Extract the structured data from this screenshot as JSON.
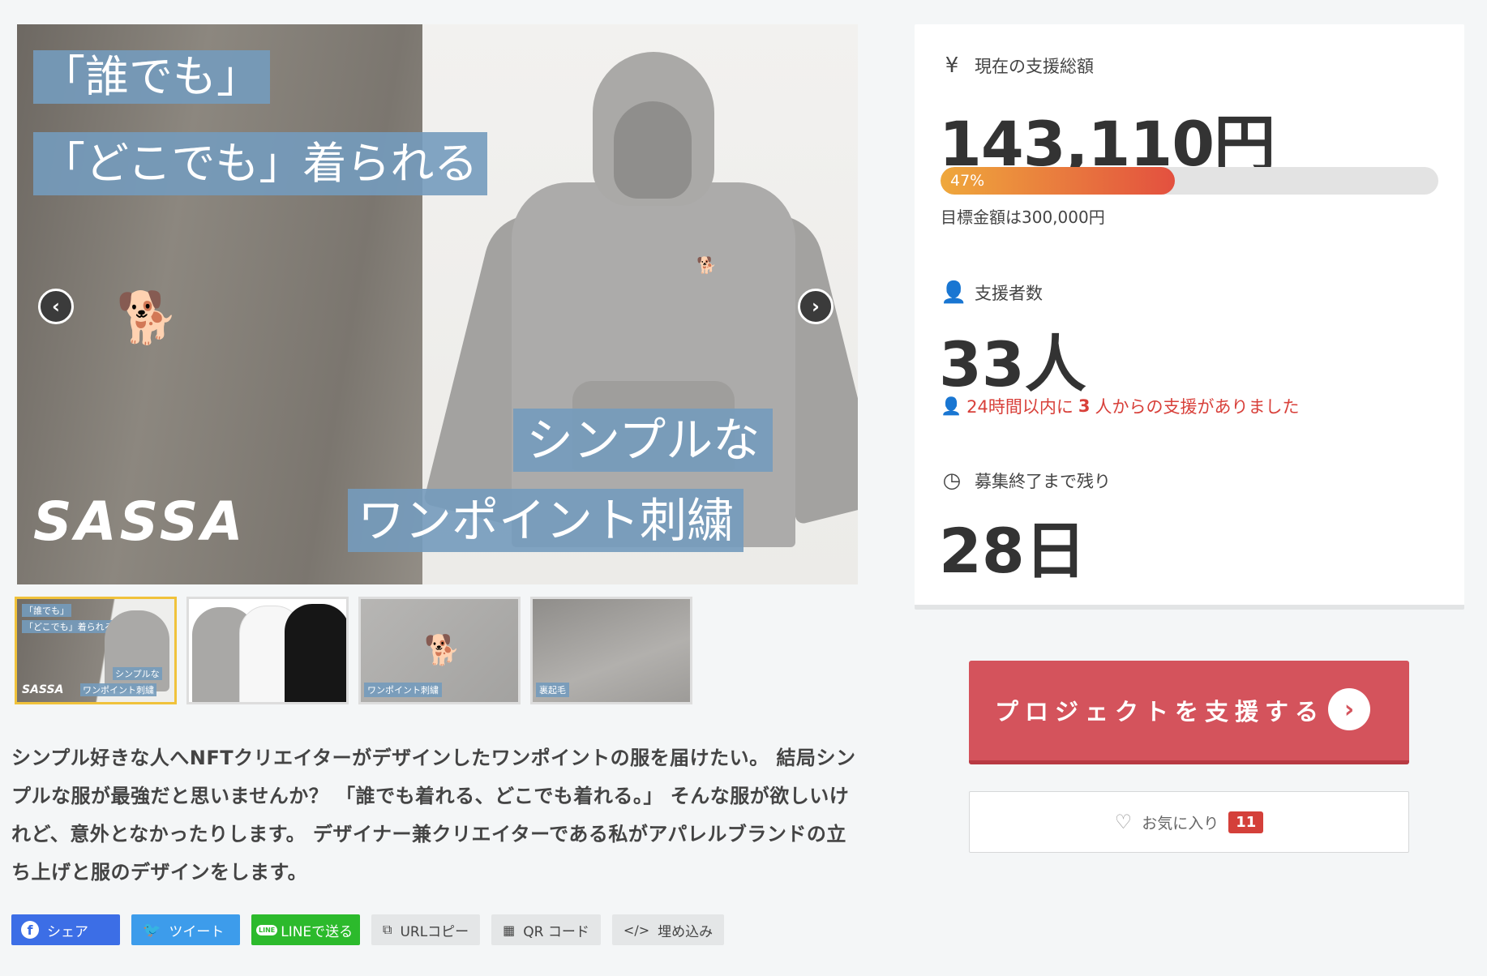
{
  "hero": {
    "caption_1": "「誰でも」",
    "caption_2": "「どこでも」着られる",
    "caption_3": "シンプルな",
    "caption_4": "ワンポイント刺繍",
    "brand": "SASSA",
    "prev_icon": "chevron-left-icon",
    "next_icon": "chevron-right-icon"
  },
  "thumbnails": [
    {
      "label_a": "「誰でも」",
      "label_b": "「どこでも」着られる",
      "label_c": "シンプルな",
      "label_d": "ワンポイント刺繍",
      "brand": "SASSA",
      "active": true
    },
    {
      "label": "",
      "active": false
    },
    {
      "label": "ワンポイント刺繍",
      "active": false
    },
    {
      "label": "裏起毛",
      "active": false
    }
  ],
  "description": "シンプル好きな人へNFTクリエイターがデザインしたワンポイントの服を届けたい。 結局シンプルな服が最強だと思いませんか？ 「誰でも着れる、どこでも着れる。」 そんな服が欲しいけれど、意外となかったりします。 デザイナー兼クリエイターである私がアパレルブランドの立ち上げと服のデザインをします。",
  "share": {
    "facebook": "シェア",
    "twitter": "ツイート",
    "line": "LINEで送る",
    "line_badge": "LINE",
    "url_copy": "URLコピー",
    "qr": "QR コード",
    "embed": "埋め込み"
  },
  "stats": {
    "amount_label": "現在の支援総額",
    "amount": "143,110円",
    "progress_percent": 47,
    "progress_text": "47%",
    "goal": "目標金額は300,000円",
    "supporters_label": "支援者数",
    "supporters": "33人",
    "recent_prefix": "24時間以内に",
    "recent_count": "3",
    "recent_suffix": "人からの支援がありました",
    "time_label": "募集終了まで残り",
    "days_left": "28日"
  },
  "cta": {
    "label": "プロジェクトを支援する"
  },
  "favorite": {
    "label": "お気に入り",
    "count": "11"
  },
  "colors": {
    "accent": "#d4535c",
    "progress_start": "#efa83c",
    "progress_end": "#e3503f",
    "alert": "#d8403a",
    "caption_bg": "#749bbc",
    "thumb_active": "#f0c23b"
  }
}
